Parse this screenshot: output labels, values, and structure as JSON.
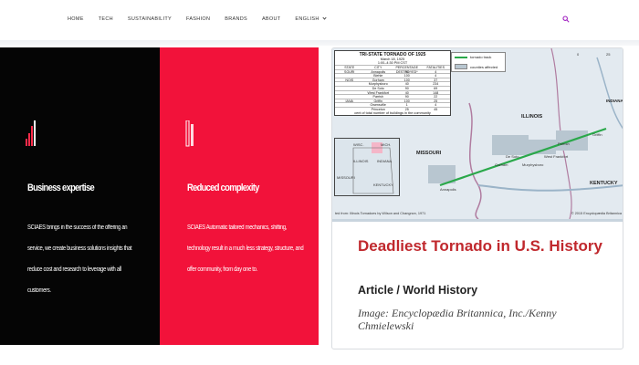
{
  "nav": {
    "items": [
      {
        "label": "HOME"
      },
      {
        "label": "TECH"
      },
      {
        "label": "SUSTAINABILITY"
      },
      {
        "label": "FASHION"
      },
      {
        "label": "BRANDS"
      },
      {
        "label": "ABOUT"
      },
      {
        "label": "ENGLISH"
      }
    ],
    "search_icon": "search-icon",
    "accent": "#a020c0"
  },
  "panels": [
    {
      "title": "Business expertise",
      "text": "SCIAES brings in the success of the offering an service, we create business solutions insights that reduce cost and research to leverage with all customers.",
      "background": "#050505",
      "icon": "chart-bars-icon"
    },
    {
      "title": "Reduced complexity",
      "text": "SCIAES Automatic tailored mechanics, shifting, technology result in a much less strategy, structure, and offer community, from day one to.",
      "background": "#f2123a",
      "icon": "document-bracket-icon"
    }
  ],
  "card": {
    "headline": "Deadliest Tornado in U.S. History",
    "subhead": "Article / World History",
    "credit": "Image: Encyclopædia Britannica, Inc./Kenny Chmielewski",
    "headline_color": "#c0282d",
    "map": {
      "table_title": "TRI-STATE TORNADO OF 1925",
      "table_date": "March 18, 1925",
      "table_time": "1:00–4:30 PM CST",
      "table_headers": [
        "STATE",
        "CITY",
        "PERCENTAGE DESTROYED*",
        "FATALITIES"
      ],
      "table_rows": [
        [
          "SOURI",
          "Annapolis",
          "90",
          "4"
        ],
        [
          "",
          "Biehle",
          "100",
          "4"
        ],
        [
          "NOIS",
          "Gorham",
          "100",
          "37"
        ],
        [
          "",
          "Murphysboro",
          "40",
          "234"
        ],
        [
          "",
          "De Soto",
          "90",
          "69"
        ],
        [
          "",
          "West Frankfort",
          "40",
          "148"
        ],
        [
          "",
          "Parrish",
          "90",
          "22"
        ],
        [
          "IANA",
          "Griffin",
          "100",
          "25"
        ],
        [
          "",
          "Owensville",
          "1",
          "4"
        ],
        [
          "",
          "Princeton",
          "25",
          "45"
        ]
      ],
      "table_note": "cent of total number of buildings in the community",
      "legend": [
        "tornado track",
        "counties affected"
      ],
      "states": [
        "ILLINOIS",
        "MISSOURI",
        "INDIANA",
        "KENTUCKY"
      ],
      "inset_labels": [
        "WISC.",
        "MICH.",
        "ILLINOIS",
        "INDIANA",
        "MISSOURI",
        "KENTUCKY"
      ],
      "towns": [
        "Parrish",
        "De Soto",
        "West Frankfort",
        "Gorham",
        "Murphysboro",
        "Griffin",
        "Annapolis"
      ],
      "scale": [
        "0",
        "25"
      ],
      "source": "ted from: Illinois Tornadoes by Wilson and Changnon, 1971",
      "copyright": "© 2015 Encyclopædia Britannica"
    }
  }
}
